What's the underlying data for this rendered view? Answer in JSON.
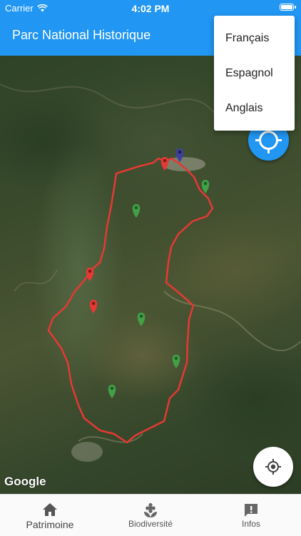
{
  "status_bar": {
    "carrier": "Carrier",
    "time": "4:02 PM"
  },
  "app_bar": {
    "title": "Parc National Historique"
  },
  "language_menu": {
    "items": [
      "Français",
      "Espagnol",
      "Anglais"
    ]
  },
  "map": {
    "attribution": "Google",
    "route_color": "#e53935",
    "marker_colors": {
      "red": "#e53935",
      "green": "#43a047",
      "navy": "#3f3fa0"
    }
  },
  "bottom_nav": {
    "items": [
      {
        "label": "Patrimoine",
        "icon": "home-icon"
      },
      {
        "label": "Biodiversité",
        "icon": "flower-icon"
      },
      {
        "label": "Infos",
        "icon": "info-alert-icon"
      }
    ]
  },
  "colors": {
    "primary": "#2196f3"
  }
}
